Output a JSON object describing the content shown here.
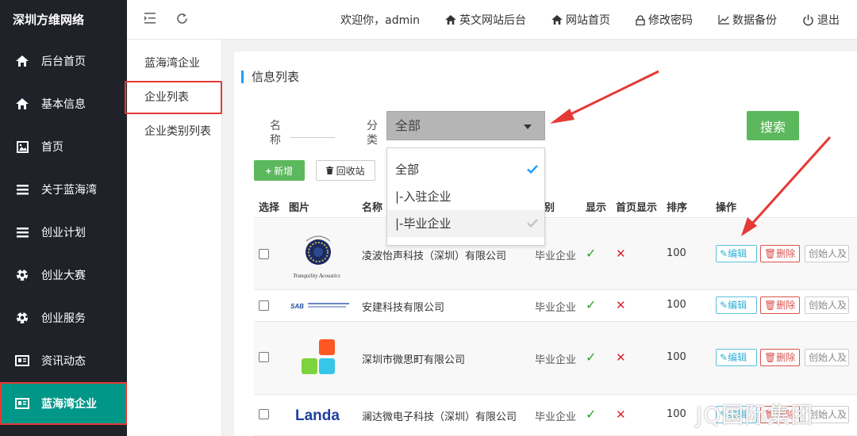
{
  "brand": "深圳方维网络",
  "sidebar": {
    "items": [
      {
        "label": "后台首页",
        "icon": "home-icon"
      },
      {
        "label": "基本信息",
        "icon": "home-icon"
      },
      {
        "label": "首页",
        "icon": "image-icon"
      },
      {
        "label": "关于蓝海湾",
        "icon": "list-icon"
      },
      {
        "label": "创业计划",
        "icon": "list-icon"
      },
      {
        "label": "创业大赛",
        "icon": "soccer-ball-icon"
      },
      {
        "label": "创业服务",
        "icon": "soccer-ball-icon"
      },
      {
        "label": "资讯动态",
        "icon": "newspaper-icon"
      },
      {
        "label": "蓝海湾企业",
        "icon": "newspaper-icon",
        "active": true
      }
    ]
  },
  "header": {
    "welcome": "欢迎你，admin",
    "links": [
      {
        "label": "英文网站后台",
        "icon": "home-icon"
      },
      {
        "label": "网站首页",
        "icon": "home-icon"
      },
      {
        "label": "修改密码",
        "icon": "lock-icon"
      },
      {
        "label": "数据备份",
        "icon": "chart-icon"
      },
      {
        "label": "退出",
        "icon": "power-icon"
      }
    ]
  },
  "subnav": {
    "items": [
      {
        "label": "蓝海湾企业"
      },
      {
        "label": "企业列表",
        "active": true
      },
      {
        "label": "企业类别列表"
      }
    ]
  },
  "main": {
    "title": "信息列表",
    "filter": {
      "name_label": "名称",
      "name_value": "",
      "category_label": "分类",
      "category_selected": "全部",
      "options": [
        "全部",
        "|-入驻企业",
        "|-毕业企业"
      ],
      "search_label": "搜索"
    },
    "toolbar": {
      "add_label": "新增",
      "recycle_label": "回收站"
    },
    "columns": [
      "选择",
      "图片",
      "名称",
      "别",
      "显示",
      "首页显示",
      "排序",
      "操作"
    ],
    "rows": [
      {
        "name": "凌波怡声科技（深圳）有限公司",
        "category": "毕业企业",
        "show": true,
        "home": false,
        "order": "100",
        "logo": "Tranquility Acoustics"
      },
      {
        "name": "安建科技有限公司",
        "category": "毕业企业",
        "show": true,
        "home": false,
        "order": "100",
        "logo": "SAB"
      },
      {
        "name": "深圳市微思町有限公司",
        "category": "毕业企业",
        "show": true,
        "home": false,
        "order": "100",
        "logo": ""
      },
      {
        "name": "澜达微电子科技（深圳）有限公司",
        "category": "毕业企业",
        "show": true,
        "home": false,
        "order": "100",
        "logo": "Landa"
      }
    ],
    "actions": {
      "edit": "编辑",
      "delete": "删除",
      "founder": "创始人及"
    }
  },
  "watermark": "JQ国际集团",
  "colors": {
    "sidebar_bg": "#20222a",
    "active": "#009688",
    "green": "#5cb85c",
    "accent_blue": "#1e9fff",
    "annotation_red": "#e53935"
  }
}
